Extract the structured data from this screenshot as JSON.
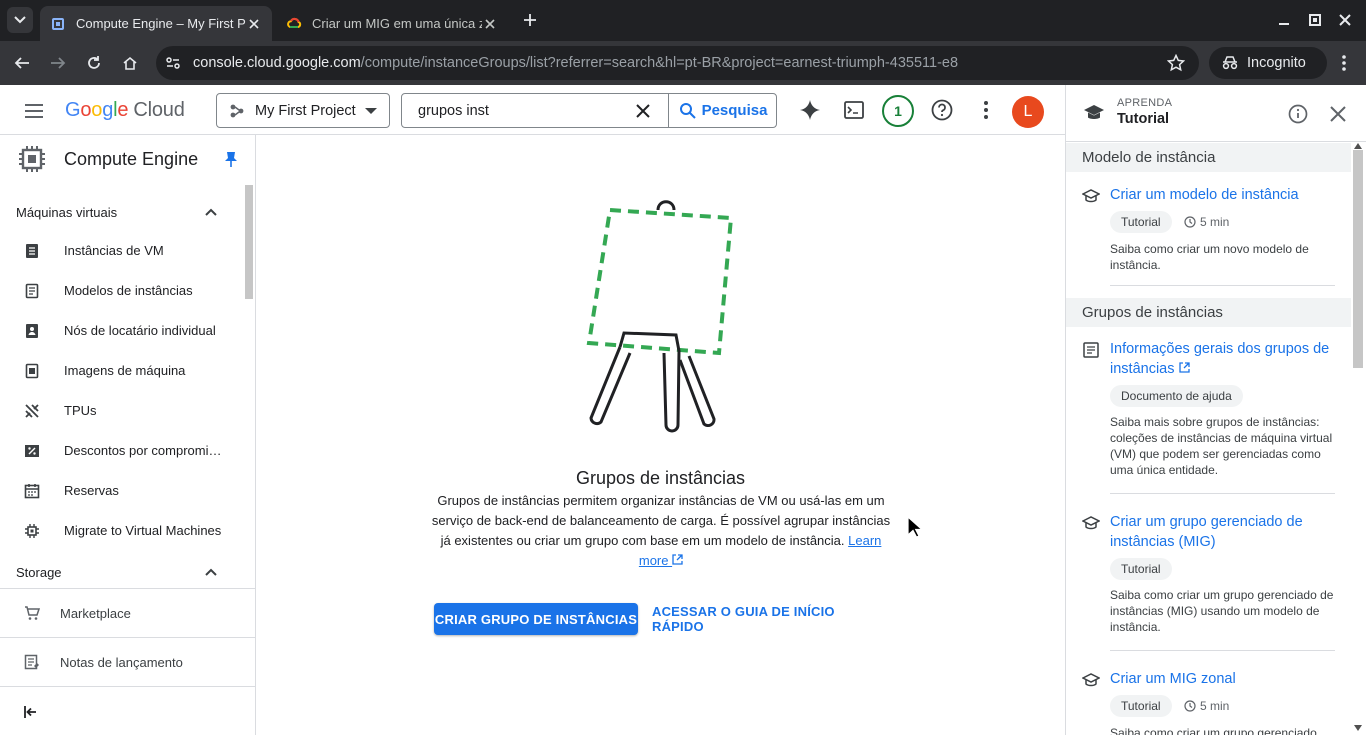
{
  "browser": {
    "tabs": [
      {
        "title": "Compute Engine – My First P",
        "active": true
      },
      {
        "title": "Criar um MIG em uma única z",
        "active": false
      }
    ],
    "url_host": "console.cloud.google.com",
    "url_path": "/compute/instanceGroups/list?referrer=search&hl=pt-BR&project=earnest-triumph-435511-e8",
    "incognito_label": "Incognito"
  },
  "header": {
    "logo_google": "Google",
    "logo_cloud": "Cloud",
    "project": "My First Project",
    "search_value": "grupos inst",
    "search_button": "Pesquisa",
    "notification_count": "1",
    "avatar_letter": "L"
  },
  "sidebar": {
    "title": "Compute Engine",
    "sections": [
      {
        "label": "Máquinas virtuais"
      },
      {
        "label": "Storage"
      }
    ],
    "items": [
      {
        "label": "Instâncias de VM",
        "icon": "vm-instances-icon"
      },
      {
        "label": "Modelos de instâncias",
        "icon": "instance-templates-icon"
      },
      {
        "label": "Nós de locatário individual",
        "icon": "sole-tenant-icon"
      },
      {
        "label": "Imagens de máquina",
        "icon": "machine-images-icon"
      },
      {
        "label": "TPUs",
        "icon": "tpu-icon"
      },
      {
        "label": "Descontos por compromisso",
        "icon": "discount-icon"
      },
      {
        "label": "Reservas",
        "icon": "calendar-icon"
      },
      {
        "label": "Migrate to Virtual Machines",
        "icon": "migrate-icon"
      }
    ],
    "footer": [
      {
        "label": "Marketplace",
        "icon": "cart-icon"
      },
      {
        "label": "Notas de lançamento",
        "icon": "release-notes-icon"
      }
    ]
  },
  "main": {
    "title": "Grupos de instâncias",
    "description": "Grupos de instâncias permitem organizar instâncias de VM ou usá-las em um serviço de back-end de balanceamento de carga. É possível agrupar instâncias já existentes ou criar um grupo com base em um modelo de instância.",
    "learn_more": "Learn more",
    "primary_button": "CRIAR GRUPO DE INSTÂNCIAS",
    "secondary_button": "ACESSAR O GUIA DE INÍCIO RÁPIDO"
  },
  "right_panel": {
    "kicker": "APRENDA",
    "title": "Tutorial",
    "groups": [
      {
        "label": "Modelo de instância"
      },
      {
        "label": "Grupos de instâncias"
      }
    ],
    "cards": [
      {
        "title": "Criar um modelo de instância",
        "chip": "Tutorial",
        "duration": "5 min",
        "description": "Saiba como criar um novo modelo de instância."
      },
      {
        "title": "Informações gerais dos grupos de instâncias",
        "chip": "Documento de ajuda",
        "description": "Saiba mais sobre grupos de instâncias: coleções de instâncias de máquina virtual (VM) que podem ser gerenciadas como uma única entidade."
      },
      {
        "title": "Criar um grupo gerenciado de instâncias (MIG)",
        "chip": "Tutorial",
        "description": "Saiba como criar um grupo gerenciado de instâncias (MIG) usando um modelo de instância."
      },
      {
        "title": "Criar um MIG zonal",
        "chip": "Tutorial",
        "duration": "5 min",
        "description": "Saiba como criar um grupo gerenciado"
      }
    ]
  },
  "colors": {
    "accent": "#1a73e8",
    "easel_frame": "#34a853",
    "avatar": "#e8491e",
    "notification": "#188038"
  }
}
